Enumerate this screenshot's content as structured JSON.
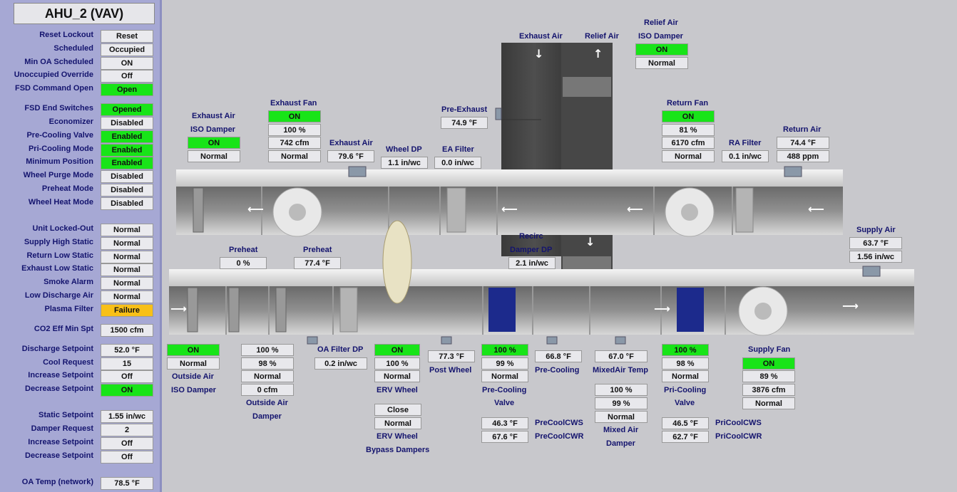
{
  "title": "AHU_2 (VAV)",
  "sidebar": {
    "rows": [
      {
        "label": "Reset Lockout",
        "value": "Reset",
        "state": "normal"
      },
      {
        "label": "Scheduled",
        "value": "Occupied",
        "state": "normal"
      },
      {
        "label": "Min OA Scheduled",
        "value": "ON",
        "state": "normal"
      },
      {
        "label": "Unoccupied Override",
        "value": "Off",
        "state": "normal"
      },
      {
        "label": "FSD Command Open",
        "value": "Open",
        "state": "green"
      },
      {
        "label": "FSD End Switches",
        "value": "Opened",
        "state": "green"
      },
      {
        "label": "Economizer",
        "value": "Disabled",
        "state": "normal"
      },
      {
        "label": "Pre-Cooling Valve",
        "value": "Enabled",
        "state": "green"
      },
      {
        "label": "Pri-Cooling Mode",
        "value": "Enabled",
        "state": "green"
      },
      {
        "label": "Minimum Position",
        "value": "Enabled",
        "state": "green"
      },
      {
        "label": "Wheel Purge Mode",
        "value": "Disabled",
        "state": "normal"
      },
      {
        "label": "Preheat Mode",
        "value": "Disabled",
        "state": "normal"
      },
      {
        "label": "Wheel Heat Mode",
        "value": "Disabled",
        "state": "normal"
      },
      {
        "label": "Unit Locked-Out",
        "value": "Normal",
        "state": "normal"
      },
      {
        "label": "Supply High Static",
        "value": "Normal",
        "state": "normal"
      },
      {
        "label": "Return Low Static",
        "value": "Normal",
        "state": "normal"
      },
      {
        "label": "Exhaust Low Static",
        "value": "Normal",
        "state": "normal"
      },
      {
        "label": "Smoke Alarm",
        "value": "Normal",
        "state": "normal"
      },
      {
        "label": "Low Discharge Air",
        "value": "Normal",
        "state": "normal"
      },
      {
        "label": "Plasma Filter",
        "value": "Failure",
        "state": "yellow"
      },
      {
        "label": "CO2 Eff Min Spt",
        "value": "1500 cfm",
        "state": "normal"
      },
      {
        "label": "Discharge Setpoint",
        "value": "52.0 °F",
        "state": "normal"
      },
      {
        "label": "Cool Request",
        "value": "15",
        "state": "normal"
      },
      {
        "label": "Increase Setpoint",
        "value": "Off",
        "state": "normal"
      },
      {
        "label": "Decrease Setpoint",
        "value": "ON",
        "state": "green"
      },
      {
        "label": "Static Setpoint",
        "value": "1.55 in/wc",
        "state": "normal"
      },
      {
        "label": "Damper Request",
        "value": "2",
        "state": "normal"
      },
      {
        "label": "Increase Setpoint",
        "value": "Off",
        "state": "normal"
      },
      {
        "label": "Decrease Setpoint",
        "value": "Off",
        "state": "normal"
      },
      {
        "label": "OA Temp (network)",
        "value": "78.5 °F",
        "state": "normal"
      }
    ]
  },
  "labels": {
    "exhaust_air_top": "Exhaust Air",
    "relief_air_top": "Relief Air",
    "relief_iso_1": "Relief Air",
    "relief_iso_2": "ISO Damper",
    "exhaust_iso_1": "Exhaust Air",
    "exhaust_iso_2": "ISO Damper",
    "exhaust_fan": "Exhaust Fan",
    "exhaust_air": "Exhaust Air",
    "wheel_dp": "Wheel DP",
    "ea_filter": "EA Filter",
    "pre_exhaust": "Pre-Exhaust",
    "return_fan": "Return Fan",
    "ra_filter": "RA Filter",
    "return_air": "Return Air",
    "recirc_1": "Recirc",
    "recirc_2": "Damper DP",
    "supply_air": "Supply Air",
    "preheat_1": "Preheat",
    "preheat_2": "Preheat",
    "oa_filter_dp": "OA Filter DP",
    "outside_air_1": "Outside Air",
    "outside_air_2": "ISO Damper",
    "oa_damper_1": "Outside Air",
    "oa_damper_2": "Damper",
    "erv_wheel": "ERV Wheel",
    "erv_bypass_1": "ERV Wheel",
    "erv_bypass_2": "Bypass Dampers",
    "post_wheel": "Post Wheel",
    "precool_valve_1": "Pre-Cooling",
    "precool_valve_2": "Valve",
    "precooling": "Pre-Cooling",
    "mixedair_temp": "MixedAir Temp",
    "mixed_damper_1": "Mixed Air",
    "mixed_damper_2": "Damper",
    "pricool_valve_1": "Pri-Cooling",
    "pricool_valve_2": "Valve",
    "supply_fan": "Supply Fan",
    "precoolcws": "PreCoolCWS",
    "precoolcwr": "PreCoolCWR",
    "pricoolcws": "PriCoolCWS",
    "pricoolcwr": "PriCoolCWR"
  },
  "values": {
    "relief_iso_on": "ON",
    "relief_iso_status": "Normal",
    "exhaust_iso_on": "ON",
    "exhaust_iso_status": "Normal",
    "exhaust_fan_on": "ON",
    "exhaust_fan_pct": "100 %",
    "exhaust_fan_cfm": "742 cfm",
    "exhaust_fan_status": "Normal",
    "exhaust_air_temp": "79.6 °F",
    "wheel_dp": "1.1 in/wc",
    "ea_filter": "0.0 in/wc",
    "pre_exhaust": "74.9 °F",
    "return_fan_on": "ON",
    "return_fan_pct": "81 %",
    "return_fan_cfm": "6170 cfm",
    "return_fan_status": "Normal",
    "ra_filter": "0.1 in/wc",
    "return_air_temp": "74.4 °F",
    "return_air_co2": "488 ppm",
    "recirc_dp": "2.1 in/wc",
    "supply_air_temp": "63.7 °F",
    "supply_air_static": "1.56 in/wc",
    "preheat_pct": "0 %",
    "preheat_temp": "77.4 °F",
    "oa_filter_dp": "0.2 in/wc",
    "outside_iso_on": "ON",
    "outside_iso_status": "Normal",
    "oa_damper_pct1": "100 %",
    "oa_damper_pct2": "98 %",
    "oa_damper_status": "Normal",
    "oa_damper_cfm": "0 cfm",
    "erv_on": "ON",
    "erv_pct": "100 %",
    "erv_status": "Normal",
    "erv_bypass_state": "Close",
    "erv_bypass_status": "Normal",
    "post_wheel_temp": "77.3 °F",
    "precool_valve_pct1": "100 %",
    "precool_valve_pct2": "99 %",
    "precool_valve_status": "Normal",
    "precooling_temp": "66.8 °F",
    "mixedair_temp": "67.0 °F",
    "mixed_damper_pct1": "100 %",
    "mixed_damper_pct2": "99 %",
    "mixed_damper_status": "Normal",
    "pricool_valve_pct1": "100 %",
    "pricool_valve_pct2": "98 %",
    "pricool_valve_status": "Normal",
    "supply_fan_on": "ON",
    "supply_fan_pct": "89 %",
    "supply_fan_cfm": "3876 cfm",
    "supply_fan_status": "Normal",
    "precoolcws": "46.3 °F",
    "precoolcwr": "67.6 °F",
    "pricoolcws": "46.5 °F",
    "pricoolcwr": "62.7 °F"
  },
  "colors": {
    "on": "#18e418",
    "fault": "#f8c018",
    "label": "#14146e",
    "sidebar": "#a6a8d4"
  },
  "icons": {
    "flow_arrow": "arrow-icon",
    "sensor": "sensor-icon",
    "fan": "fan-icon",
    "wheel": "erv-wheel-icon",
    "filter": "filter-icon",
    "coil": "coil-icon",
    "damper": "damper-icon"
  }
}
